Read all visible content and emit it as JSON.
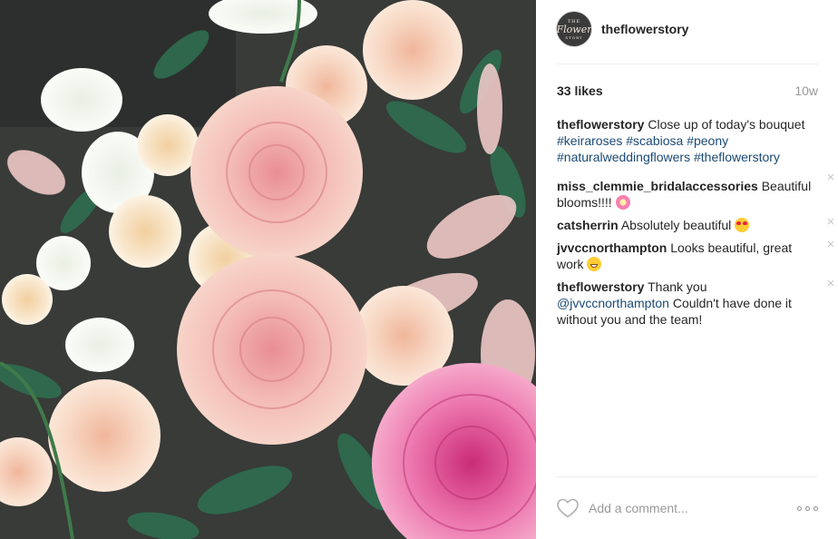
{
  "post": {
    "image_alt": "bouquet of roses, peonies, scabiosa and astilbe"
  },
  "header": {
    "avatar": {
      "line1": "THE",
      "line2": "Flower",
      "line3": "STORY"
    },
    "username": "theflowerstory"
  },
  "stats": {
    "likes": "33 likes",
    "time": "10w"
  },
  "caption": {
    "user": "theflowerstory",
    "text": "Close up of today's bouquet",
    "hashtags": [
      "#keiraroses",
      "#scabiosa",
      "#peony",
      "#naturalweddingflowers",
      "#theflowerstory"
    ]
  },
  "comments": [
    {
      "user": "miss_clemmie_bridalaccessories",
      "text": "Beautiful blooms!!!!",
      "emoji": "flower-emoji"
    },
    {
      "user": "catsherrin",
      "text": "Absolutely beautiful",
      "emoji": "heart-eyes-emoji"
    },
    {
      "user": "jvvccnorthampton",
      "text": "Looks beautiful, great work",
      "emoji": "grin-emoji"
    },
    {
      "user": "theflowerstory",
      "text_before": "Thank you",
      "mention": "@jvvccnorthampton",
      "text_after": "Couldn't have done it without you and the team!"
    }
  ],
  "remove_symbol": "×",
  "footer": {
    "placeholder": "Add a comment...",
    "more_icon": "ellipsis-icon",
    "like_icon": "heart-outline-icon"
  },
  "colors": {
    "link": "#1a4a76",
    "muted": "#999999",
    "text": "#262626"
  }
}
